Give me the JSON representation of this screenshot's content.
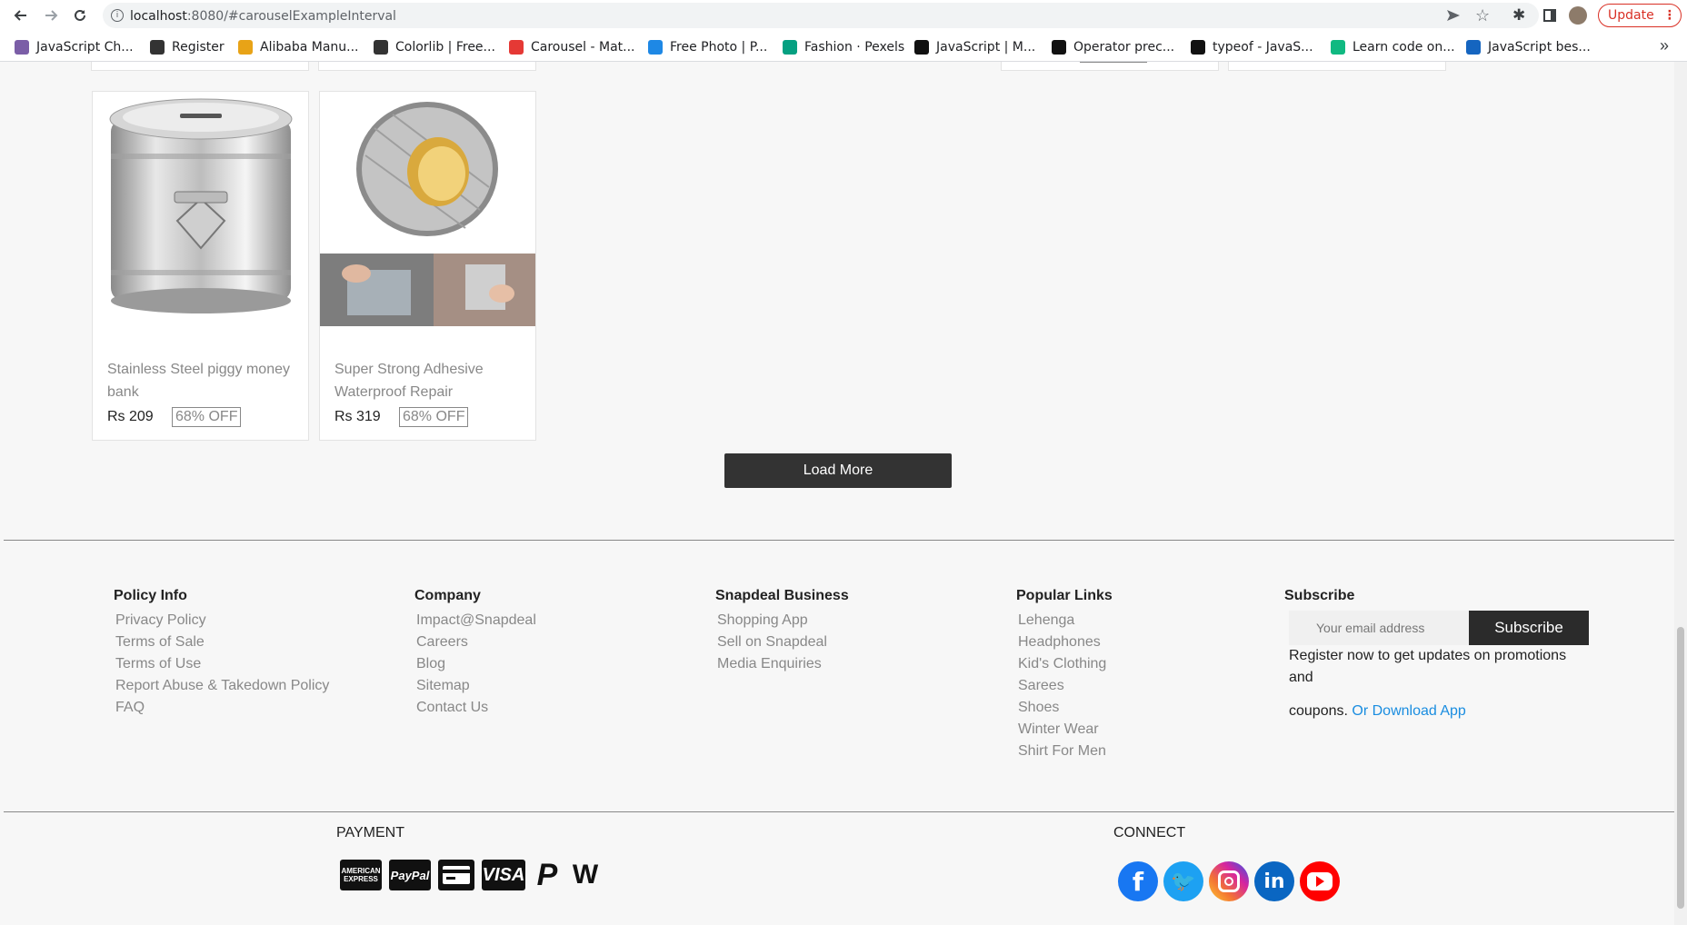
{
  "browser": {
    "url_host": "localhost",
    "url_rest": ":8080/#carouselExampleInterval",
    "update_label": "Update",
    "bookmarks": [
      {
        "label": "JavaScript Ch...",
        "color": "#7b5ea7"
      },
      {
        "label": "Register",
        "color": "#333333"
      },
      {
        "label": "Alibaba Manu...",
        "color": "#e8a317"
      },
      {
        "label": "Colorlib | Free...",
        "color": "#333333"
      },
      {
        "label": "Carousel - Mat...",
        "color": "#e53935"
      },
      {
        "label": "Free Photo | P...",
        "color": "#1e88e5"
      },
      {
        "label": "Fashion · Pexels",
        "color": "#05a081"
      },
      {
        "label": "JavaScript | M...",
        "color": "#111111"
      },
      {
        "label": "Operator prec...",
        "color": "#111111"
      },
      {
        "label": "typeof - JavaS...",
        "color": "#111111"
      },
      {
        "label": "Learn code on...",
        "color": "#10b981"
      },
      {
        "label": "JavaScript bes...",
        "color": "#1565c0"
      }
    ]
  },
  "products": [
    {
      "title": "Stainless Steel piggy money bank",
      "price": "Rs 209",
      "discount": "68% OFF",
      "image": "steel-tin-image"
    },
    {
      "title": "Super Strong Adhesive Waterproof Repair",
      "price": "Rs 319",
      "discount": "68% OFF",
      "image": "adhesive-tape-image"
    }
  ],
  "load_more_label": "Load More",
  "footer": {
    "policy": {
      "heading": "Policy Info",
      "links": [
        "Privacy Policy",
        "Terms of Sale",
        "Terms of Use",
        "Report Abuse & Takedown Policy",
        "FAQ"
      ]
    },
    "company": {
      "heading": "Company",
      "links": [
        "Impact@Snapdeal",
        "Careers",
        "Blog",
        "Sitemap",
        "Contact Us"
      ]
    },
    "business": {
      "heading": "Snapdeal Business",
      "links": [
        "Shopping App",
        "Sell on Snapdeal",
        "Media Enquiries"
      ]
    },
    "popular": {
      "heading": "Popular Links",
      "links": [
        "Lehenga",
        "Headphones",
        "Kid's Clothing",
        "Sarees",
        "Shoes",
        "Winter Wear",
        "Shirt For Men"
      ]
    },
    "subscribe": {
      "heading": "Subscribe",
      "placeholder": "Your email address",
      "button": "Subscribe",
      "text": "Register now to get updates on promotions and",
      "text2": "coupons.",
      "app_link": "Or Download App"
    }
  },
  "payment": {
    "title": "PAYMENT",
    "methods": [
      "American Express",
      "PayPal",
      "Card",
      "VISA",
      "PayPal-P",
      "Wallet"
    ]
  },
  "connect": {
    "title": "CONNECT",
    "networks": [
      "facebook-icon",
      "twitter-icon",
      "instagram-icon",
      "linkedin-icon",
      "youtube-icon"
    ]
  },
  "colors": {
    "facebook": "#1877f2",
    "twitter": "#1da1f2",
    "instagram": "#d6249f",
    "linkedin": "#0a66c2",
    "youtube": "#ff0000",
    "link_blue": "#1a8de0"
  }
}
